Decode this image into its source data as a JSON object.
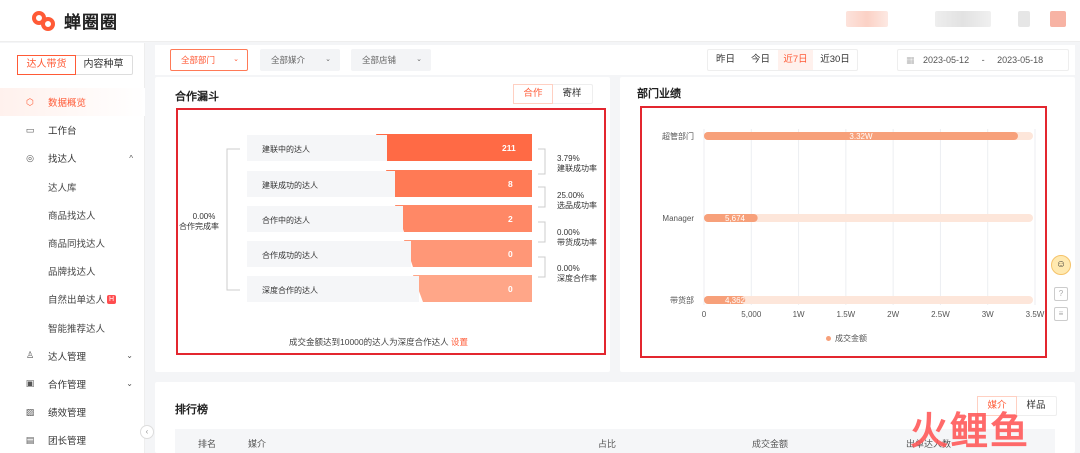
{
  "header": {
    "logo_text": "蝉圈圈"
  },
  "sidebar": {
    "tabs": [
      {
        "label": "达人带货"
      },
      {
        "label": "内容种草"
      }
    ],
    "items": [
      {
        "label": "数据概览",
        "icon": "shield-icon"
      },
      {
        "label": "工作台",
        "icon": "monitor-icon"
      },
      {
        "label": "找达人",
        "icon": "user-search-icon"
      },
      {
        "label": "达人库"
      },
      {
        "label": "商品找达人"
      },
      {
        "label": "商品同找达人"
      },
      {
        "label": "品牌找达人"
      },
      {
        "label": "自然出单达人",
        "badge": "H"
      },
      {
        "label": "智能推荐达人"
      },
      {
        "label": "达人管理",
        "icon": "user-manage-icon"
      },
      {
        "label": "合作管理",
        "icon": "clipboard-icon"
      },
      {
        "label": "绩效管理",
        "icon": "chart-icon"
      },
      {
        "label": "团长管理",
        "icon": "team-icon"
      }
    ]
  },
  "filters": {
    "department": "全部部门",
    "media": "全部媒介",
    "store": "全部店铺",
    "ranges": [
      "昨日",
      "今日",
      "近7日",
      "近30日"
    ],
    "date_start": "2023-05-12",
    "date_sep": "-",
    "date_end": "2023-05-18"
  },
  "funnel": {
    "title": "合作漏斗",
    "toggle": [
      "合作",
      "寄样"
    ],
    "completion_rate": "0.00%",
    "completion_label": "合作完成率",
    "stages": [
      {
        "label": "建联中的达人",
        "value": "211"
      },
      {
        "label": "建联成功的达人",
        "value": "8"
      },
      {
        "label": "合作中的达人",
        "value": "2"
      },
      {
        "label": "合作成功的达人",
        "value": "0"
      },
      {
        "label": "深度合作的达人",
        "value": "0"
      }
    ],
    "rates": [
      {
        "value": "3.79%",
        "label": "建联成功率"
      },
      {
        "value": "25.00%",
        "label": "选品成功率"
      },
      {
        "value": "0.00%",
        "label": "带货成功率"
      },
      {
        "value": "0.00%",
        "label": "深度合作率"
      }
    ],
    "footer_text": "成交金额达到10000的达人为深度合作达人",
    "footer_link": "设置"
  },
  "dept": {
    "title": "部门业绩",
    "chart_data": {
      "type": "bar",
      "orientation": "horizontal",
      "categories": [
        "超管部门",
        "Manager",
        "带货部"
      ],
      "series": [
        {
          "name": "成交金额",
          "values": [
            33200,
            5674,
            4362
          ]
        }
      ],
      "data_labels": [
        "3.32W",
        "5,674",
        "4,362"
      ],
      "xlim": [
        0,
        35000
      ],
      "x_ticks": [
        "0",
        "5,000",
        "1W",
        "1.5W",
        "2W",
        "2.5W",
        "3W",
        "3.5W"
      ],
      "grid": true,
      "legend_position": "bottom"
    }
  },
  "ranking": {
    "title": "排行榜",
    "toggle": [
      "媒介",
      "样品"
    ],
    "columns": [
      "排名",
      "媒介",
      "占比",
      "成交金额",
      "出单达人数"
    ]
  },
  "colors": {
    "accent": "#ff5a36",
    "bar": "#f7a07a",
    "bar_track": "#fde6da",
    "highlight_box": "#e3262f"
  }
}
